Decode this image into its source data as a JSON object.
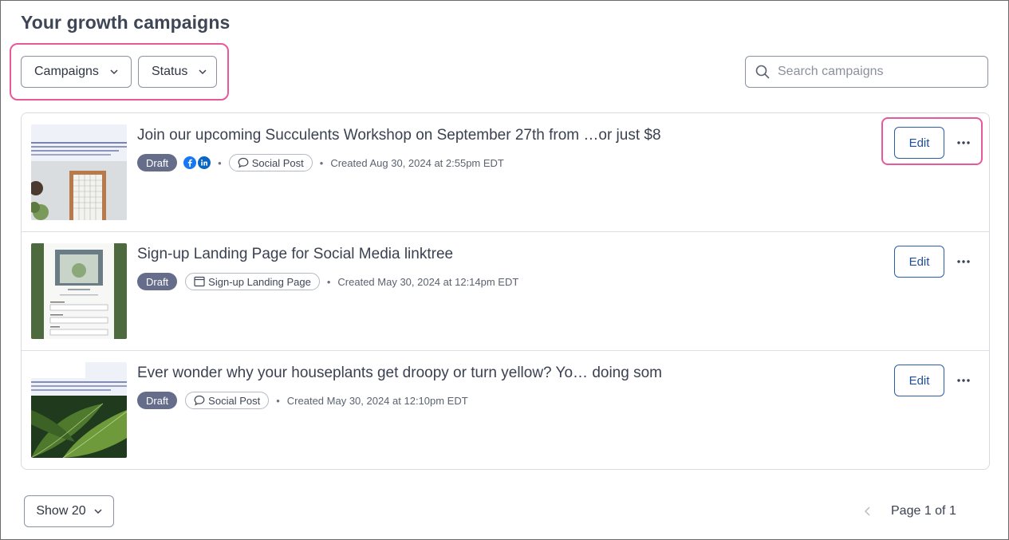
{
  "page": {
    "title": "Your growth campaigns"
  },
  "filters": {
    "campaigns_label": "Campaigns",
    "status_label": "Status"
  },
  "search": {
    "placeholder": "Search campaigns",
    "value": ""
  },
  "rows": [
    {
      "title": "Join our upcoming Succulents Workshop on September 27th from …or just $8",
      "status": "Draft",
      "channels": [
        "facebook-icon",
        "linkedin-icon"
      ],
      "type_label": "Social Post",
      "type_icon": "speech-bubble-icon",
      "created": "Created Aug 30, 2024 at 2:55pm EDT",
      "edit_label": "Edit"
    },
    {
      "title": "Sign-up Landing Page for Social Media linktree",
      "status": "Draft",
      "channels": [],
      "type_label": "Sign-up Landing Page",
      "type_icon": "browser-window-icon",
      "created": "Created May 30, 2024 at 12:14pm EDT",
      "edit_label": "Edit"
    },
    {
      "title": "Ever wonder why your houseplants get droopy or turn yellow? Yo… doing som",
      "status": "Draft",
      "channels": [],
      "type_label": "Social Post",
      "type_icon": "speech-bubble-icon",
      "created": "Created May 30, 2024 at 12:10pm EDT",
      "edit_label": "Edit"
    }
  ],
  "footer": {
    "show_label": "Show 20",
    "page_label": "Page 1 of 1"
  },
  "colors": {
    "highlight": "#e8599c",
    "badge": "#656d8a",
    "edit_border": "#2a5ea8",
    "facebook": "#1877f2",
    "linkedin": "#0a66c2"
  }
}
